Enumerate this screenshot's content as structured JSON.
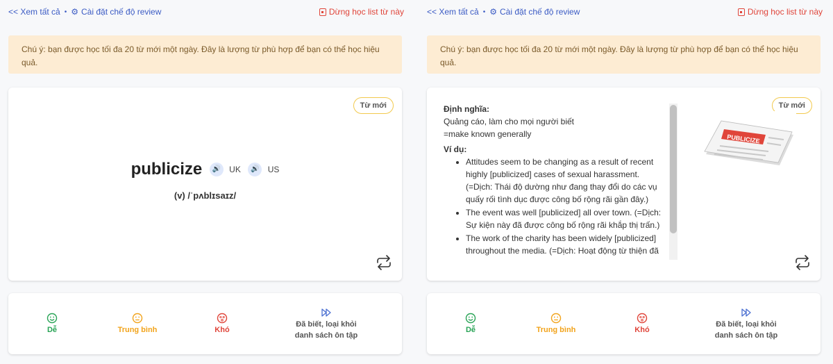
{
  "topbar": {
    "view_all": "<< Xem tất cả",
    "settings": "Cài đặt chế độ review",
    "stop": "Dừng học list từ này"
  },
  "notice": "Chú ý: bạn được học tối đa 20 từ mới một ngày. Đây là lượng từ phù hợp để bạn có thể học hiệu quả.",
  "card": {
    "badge": "Từ mới",
    "word": "publicize",
    "uk": "UK",
    "us": "US",
    "pronunciation": "(v) /ˈpʌblɪsaɪz/"
  },
  "definition": {
    "heading": "Định nghĩa:",
    "lines": [
      "Quảng cáo, làm cho mọi người biết",
      "=make known generally"
    ],
    "examples_heading": "Ví dụ:",
    "examples": [
      "Attitudes seem to be changing as a result of recent highly [publicized] cases of sexual harassment. (=Dịch: Thái độ dường như đang thay đổi do các vụ quấy rối tình dục được công bố rộng rãi gần đây.)",
      "The event was well [publicized] all over town. (=Dịch: Sự kiện này đã được công bố rộng rãi khắp thị trấn.)",
      "The work of the charity has been widely [publicized] throughout the media. (=Dịch: Hoạt động từ thiện đã"
    ],
    "image_caption": "PUBLICIZE"
  },
  "rating": {
    "easy": "Dễ",
    "medium": "Trung bình",
    "hard": "Khó",
    "known_line1": "Đã biết, loại khỏi",
    "known_line2": "danh sách ôn tập"
  },
  "colors": {
    "link": "#3b5bc4",
    "danger": "#e0453a",
    "notice_bg": "#fdecd3",
    "easy": "#27a355",
    "medium": "#f2a31a",
    "hard": "#e0453a",
    "badge_border": "#f2c94c"
  }
}
